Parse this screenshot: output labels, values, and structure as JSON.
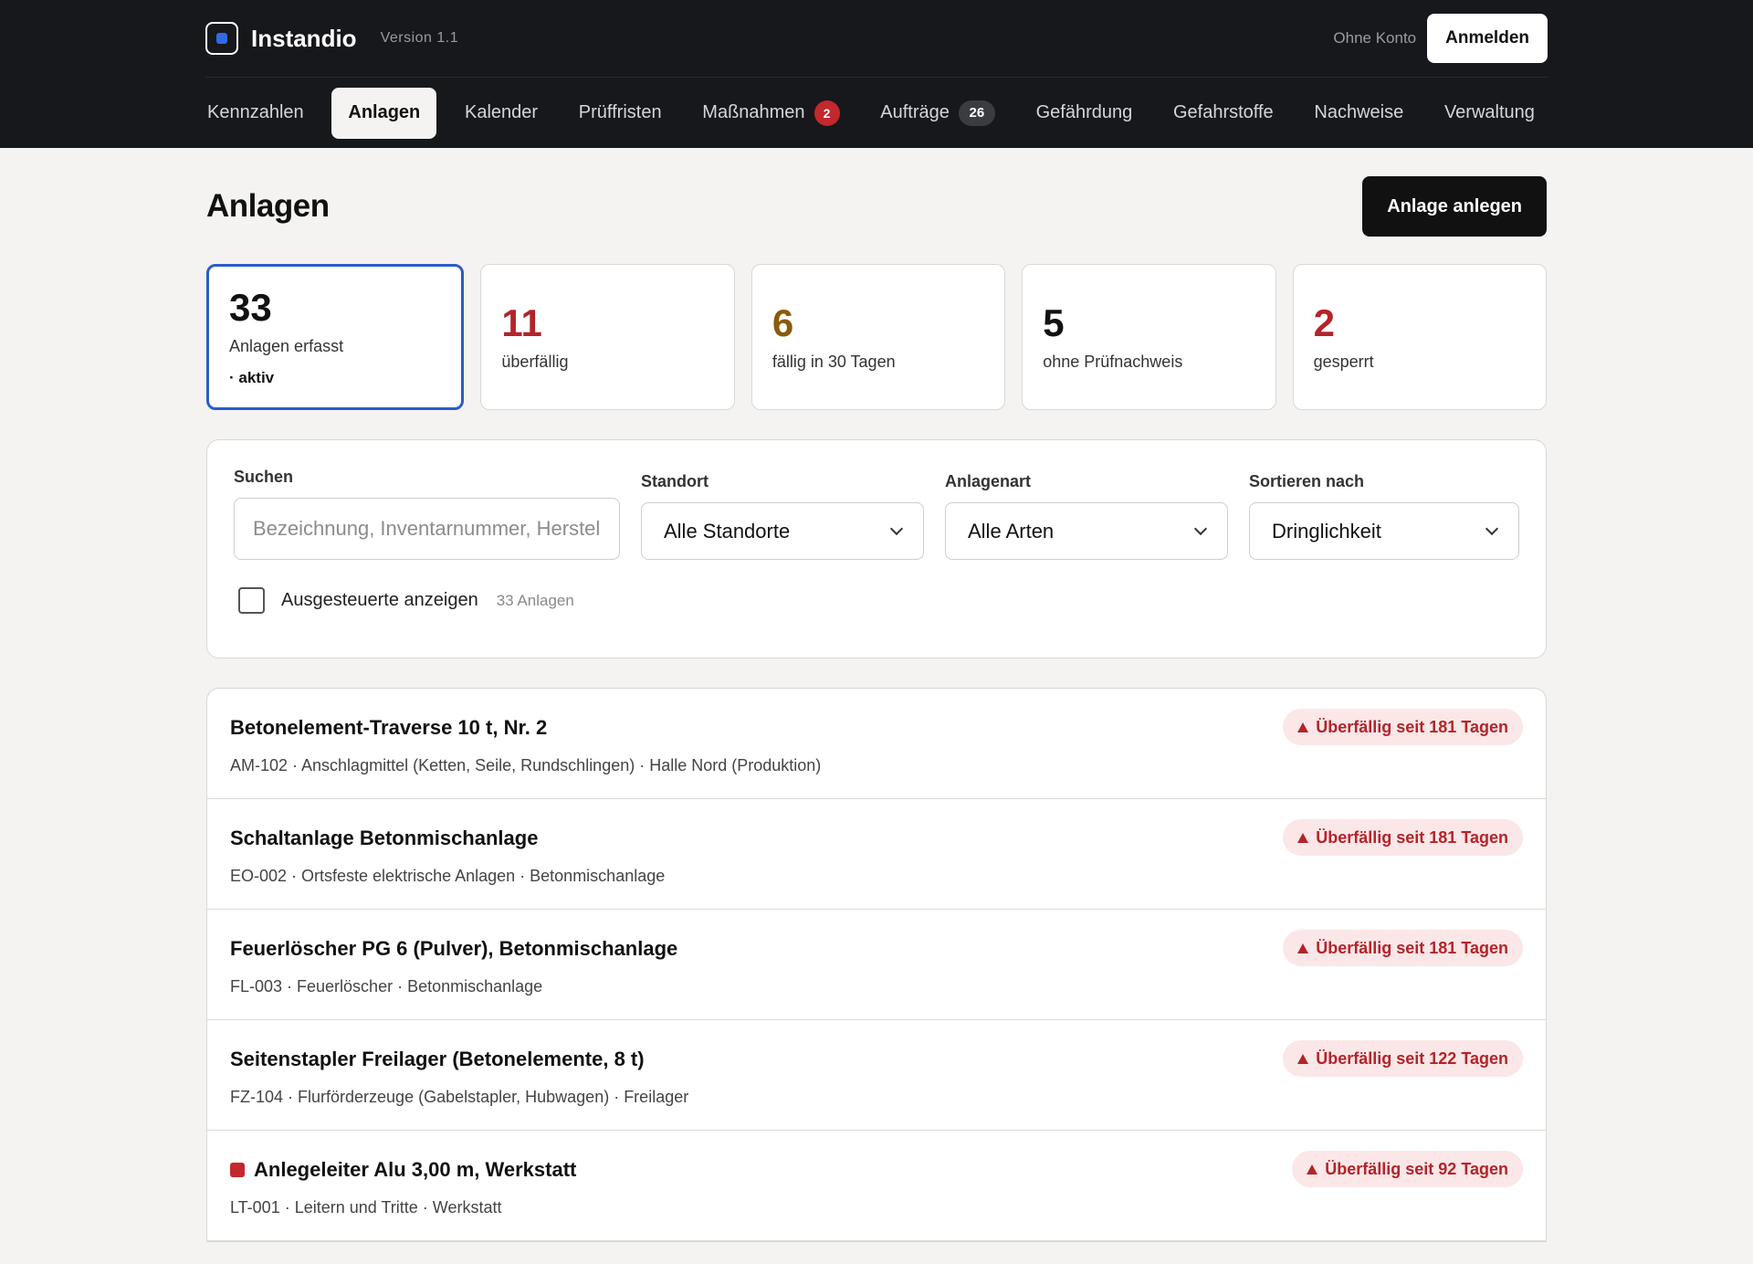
{
  "app": {
    "name": "Instandio",
    "version": "Version 1.1"
  },
  "auth": {
    "no_account": "Ohne Konto",
    "login": "Anmelden"
  },
  "nav": [
    {
      "label": "Kennzahlen",
      "active": false
    },
    {
      "label": "Anlagen",
      "active": true
    },
    {
      "label": "Kalender",
      "active": false
    },
    {
      "label": "Prüffristen",
      "active": false
    },
    {
      "label": "Maßnahmen",
      "active": false,
      "badge": "2",
      "badge_color": "#c2282d"
    },
    {
      "label": "Aufträge",
      "active": false,
      "badge": "26",
      "badge_color": "#3b3c41"
    },
    {
      "label": "Gefährdung",
      "active": false
    },
    {
      "label": "Gefahrstoffe",
      "active": false
    },
    {
      "label": "Nachweise",
      "active": false
    },
    {
      "label": "Verwaltung",
      "active": false
    }
  ],
  "page": {
    "title": "Anlagen",
    "create_button": "Anlage anlegen"
  },
  "stats": [
    {
      "value": "33",
      "label": "Anlagen erfasst",
      "sub": "· aktiv",
      "color": "#111111",
      "selected": true
    },
    {
      "value": "11",
      "label": "überfällig",
      "color": "#b3242a"
    },
    {
      "value": "6",
      "label": "fällig in 30 Tagen",
      "color": "#8a5a0a"
    },
    {
      "value": "5",
      "label": "ohne Prüfnachweis",
      "color": "#111111"
    },
    {
      "value": "2",
      "label": "gesperrt",
      "color": "#b3242a"
    }
  ],
  "filters": {
    "search_label": "Suchen",
    "search_placeholder": "Bezeichnung, Inventarnummer, Herstel",
    "location_label": "Standort",
    "location_value": "Alle Standorte",
    "type_label": "Anlagenart",
    "type_value": "Alle Arten",
    "sort_label": "Sortieren nach",
    "sort_value": "Dringlichkeit",
    "show_retired_label": "Ausgesteuerte anzeigen",
    "show_retired_checked": false,
    "count": "33 Anlagen"
  },
  "assets": [
    {
      "title": "Betonelement-Traverse 10 t, Nr. 2",
      "meta": "AM-102 · Anschlagmittel (Ketten, Seile, Rundschlingen) · Halle Nord (Produktion)",
      "status": "Überfällig seit 181 Tagen",
      "locked": false
    },
    {
      "title": "Schaltanlage Betonmischanlage",
      "meta": "EO-002 · Ortsfeste elektrische Anlagen · Betonmischanlage",
      "status": "Überfällig seit 181 Tagen",
      "locked": false
    },
    {
      "title": "Feuerlöscher PG 6 (Pulver), Betonmischanlage",
      "meta": "FL-003 · Feuerlöscher · Betonmischanlage",
      "status": "Überfällig seit 181 Tagen",
      "locked": false
    },
    {
      "title": "Seitenstapler Freilager (Betonelemente, 8 t)",
      "meta": "FZ-104 · Flurförderzeuge (Gabelstapler, Hubwagen) · Freilager",
      "status": "Überfällig seit 122 Tagen",
      "locked": false
    },
    {
      "title": "Anlegeleiter Alu 3,00 m, Werkstatt",
      "meta": "LT-001 · Leitern und Tritte · Werkstatt",
      "status": "Überfällig seit 92 Tagen",
      "locked": true
    }
  ],
  "colors": {
    "accent": "#2c5ccc",
    "danger": "#b3242a",
    "warning": "#8a5a0a",
    "topbar": "#17181b"
  }
}
